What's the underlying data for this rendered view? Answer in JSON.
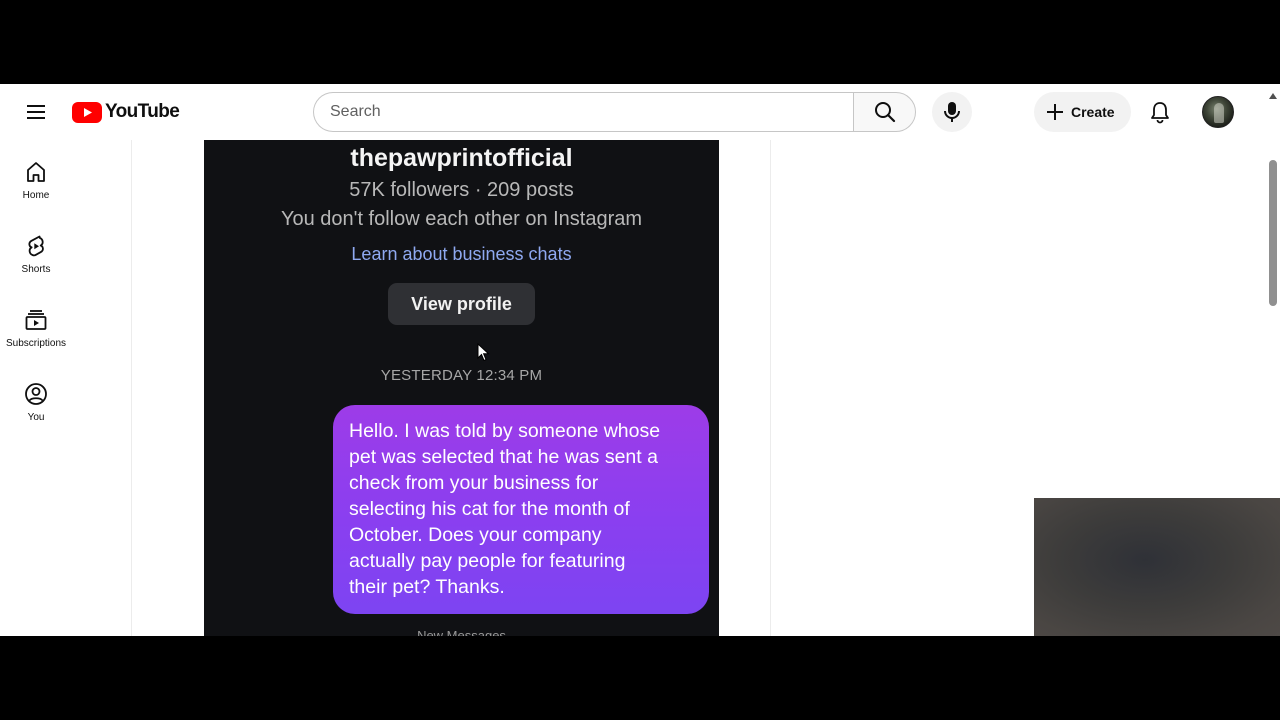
{
  "header": {
    "logo_text": "YouTube",
    "search_placeholder": "Search",
    "create_label": "Create"
  },
  "sidebar": {
    "items": [
      {
        "label": "Home",
        "icon": "home-icon"
      },
      {
        "label": "Shorts",
        "icon": "shorts-icon"
      },
      {
        "label": "Subscriptions",
        "icon": "subscriptions-icon"
      },
      {
        "label": "You",
        "icon": "account-icon"
      }
    ]
  },
  "video": {
    "profile_name": "thepawprintofficial",
    "stats": "57K followers · 209 posts",
    "follow_status": "You don't follow each other on Instagram",
    "learn_link": "Learn about business chats",
    "view_profile_label": "View profile",
    "timestamp": "YESTERDAY 12:34 PM",
    "message_lines": [
      "Hello. I was told by someone whose",
      "pet was selected that he was sent a",
      "check from your business for",
      "selecting his cat for the month of",
      "October. Does your company",
      "actually pay people for featuring",
      "their pet? Thanks."
    ],
    "bottom_label": "New Messages",
    "bubble_color": "#8a3ff0"
  },
  "colors": {
    "brand_red": "#ff0000",
    "link_blue": "#8fa9f0",
    "chat_bg": "#101114"
  }
}
